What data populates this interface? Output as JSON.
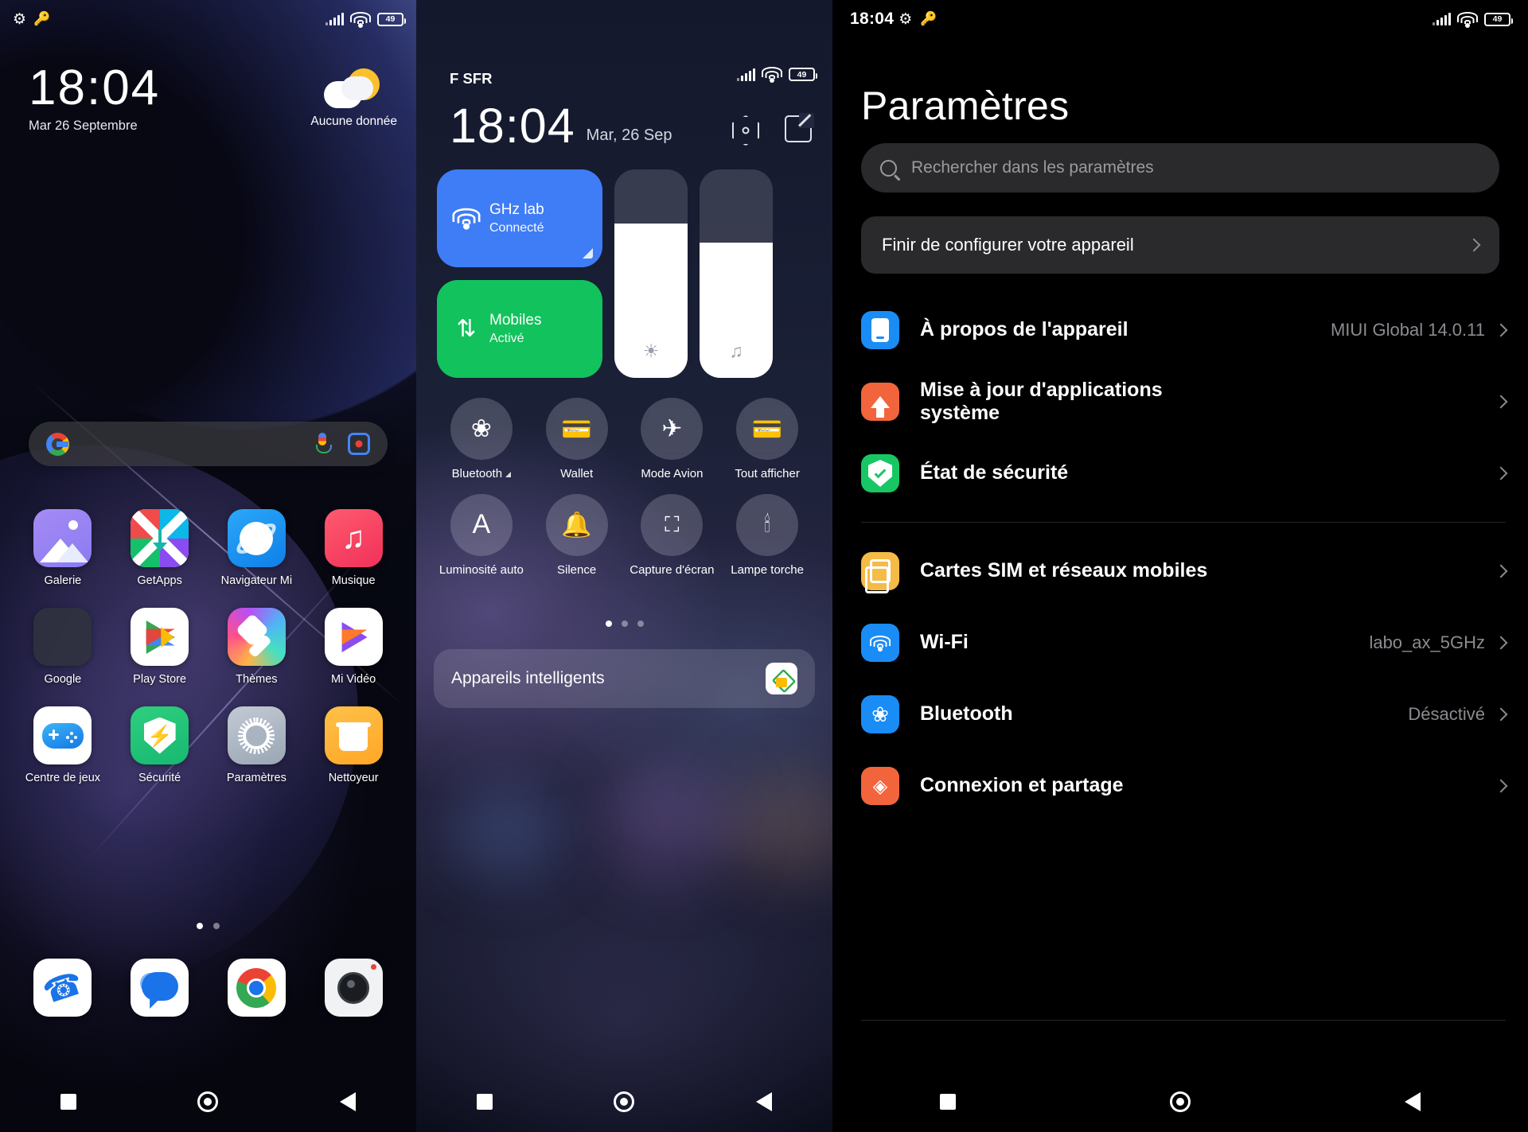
{
  "panel1": {
    "status": {
      "gear_icon": "gear-icon",
      "key_icon": "key-icon",
      "battery": "49"
    },
    "clock": {
      "time": "18:04",
      "date": "Mar 26 Septembre"
    },
    "weather": {
      "text": "Aucune donnée",
      "icon": "sun-behind-cloud-icon"
    },
    "search": {
      "google_icon": "google-g-icon",
      "mic_icon": "microphone-icon",
      "lens_icon": "google-lens-icon"
    },
    "apps": [
      [
        {
          "label": "Galerie",
          "icon": "gallery-icon"
        },
        {
          "label": "GetApps",
          "icon": "getapps-icon"
        },
        {
          "label": "Navigateur Mi",
          "icon": "mi-browser-icon"
        },
        {
          "label": "Musique",
          "icon": "music-icon"
        }
      ],
      [
        {
          "label": "Google",
          "icon": "google-folder-icon"
        },
        {
          "label": "Play Store",
          "icon": "play-store-icon"
        },
        {
          "label": "Thèmes",
          "icon": "themes-icon"
        },
        {
          "label": "Mi Vidéo",
          "icon": "mi-video-icon"
        }
      ],
      [
        {
          "label": "Centre de jeux",
          "icon": "game-center-icon"
        },
        {
          "label": "Sécurité",
          "icon": "security-icon"
        },
        {
          "label": "Paramètres",
          "icon": "settings-gear-icon"
        },
        {
          "label": "Nettoyeur",
          "icon": "cleaner-icon"
        }
      ]
    ],
    "dock": [
      {
        "label": "",
        "icon": "phone-icon"
      },
      {
        "label": "",
        "icon": "messages-icon"
      },
      {
        "label": "",
        "icon": "chrome-icon"
      },
      {
        "label": "",
        "icon": "camera-icon"
      }
    ],
    "page_dots": {
      "count": 2,
      "active": 0
    }
  },
  "panel2": {
    "carrier": "F SFR",
    "status": {
      "battery": "49"
    },
    "clock": {
      "time": "18:04",
      "date": "Mar, 26 Sep"
    },
    "actions": [
      {
        "icon": "power-hexagon-icon"
      },
      {
        "icon": "edit-pencil-icon"
      }
    ],
    "tiles": [
      {
        "title": "GHz      lab",
        "subtitle": "Connecté",
        "icon": "wifi-icon",
        "color": "#3f7df6"
      },
      {
        "title": "Mobiles",
        "subtitle": "Activé",
        "icon": "data-transfer-icon",
        "color": "#12c25c"
      }
    ],
    "sliders": [
      {
        "name": "brightness",
        "icon": "brightness-icon",
        "value": 74
      },
      {
        "name": "volume",
        "icon": "music-note-icon",
        "value": 65
      }
    ],
    "toggles": [
      {
        "label": "Bluetooth",
        "icon": "bluetooth-icon",
        "expandable": true
      },
      {
        "label": "Wallet",
        "icon": "wallet-icon",
        "expandable": false
      },
      {
        "label": "Mode Avion",
        "icon": "airplane-icon",
        "expandable": false
      },
      {
        "label": "Tout afficher",
        "icon": "wallet-cards-icon",
        "expandable": false
      },
      {
        "label": "Luminosité auto",
        "icon": "auto-brightness-a-icon",
        "expandable": false
      },
      {
        "label": "Silence",
        "icon": "bell-icon",
        "expandable": false
      },
      {
        "label": "Capture d'écran",
        "icon": "screenshot-icon",
        "expandable": false
      },
      {
        "label": "Lampe torche",
        "icon": "flashlight-icon",
        "expandable": false
      }
    ],
    "page_dots": {
      "count": 3,
      "active": 0
    },
    "smart_devices": {
      "label": "Appareils intelligents",
      "icon": "google-home-icon"
    }
  },
  "panel3": {
    "status": {
      "time": "18:04",
      "gear_icon": "gear-icon",
      "key_icon": "key-icon",
      "battery": "49"
    },
    "title": "Paramètres",
    "search": {
      "placeholder": "Rechercher dans les paramètres",
      "icon": "search-icon"
    },
    "banner": {
      "label": "Finir de configurer votre appareil",
      "chevron": "chevron-right-icon"
    },
    "group1": [
      {
        "label": "À propos de l'appareil",
        "value": "MIUI Global 14.0.11",
        "icon": "device-info-icon"
      },
      {
        "label": "Mise à jour d'applications système",
        "value": "",
        "icon": "system-update-icon"
      },
      {
        "label": "État de sécurité",
        "value": "",
        "icon": "security-shield-icon"
      }
    ],
    "group2": [
      {
        "label": "Cartes SIM et réseaux mobiles",
        "value": "",
        "icon": "sim-card-icon"
      },
      {
        "label": "Wi-Fi",
        "value": "labo_ax_5GHz",
        "icon": "wifi-icon"
      },
      {
        "label": "Bluetooth",
        "value": "Désactivé",
        "icon": "bluetooth-icon"
      },
      {
        "label": "Connexion et partage",
        "value": "",
        "icon": "connection-share-icon"
      }
    ]
  },
  "navbar": {
    "recents_icon": "square-recents-icon",
    "home_icon": "circle-home-icon",
    "back_icon": "triangle-back-icon"
  }
}
